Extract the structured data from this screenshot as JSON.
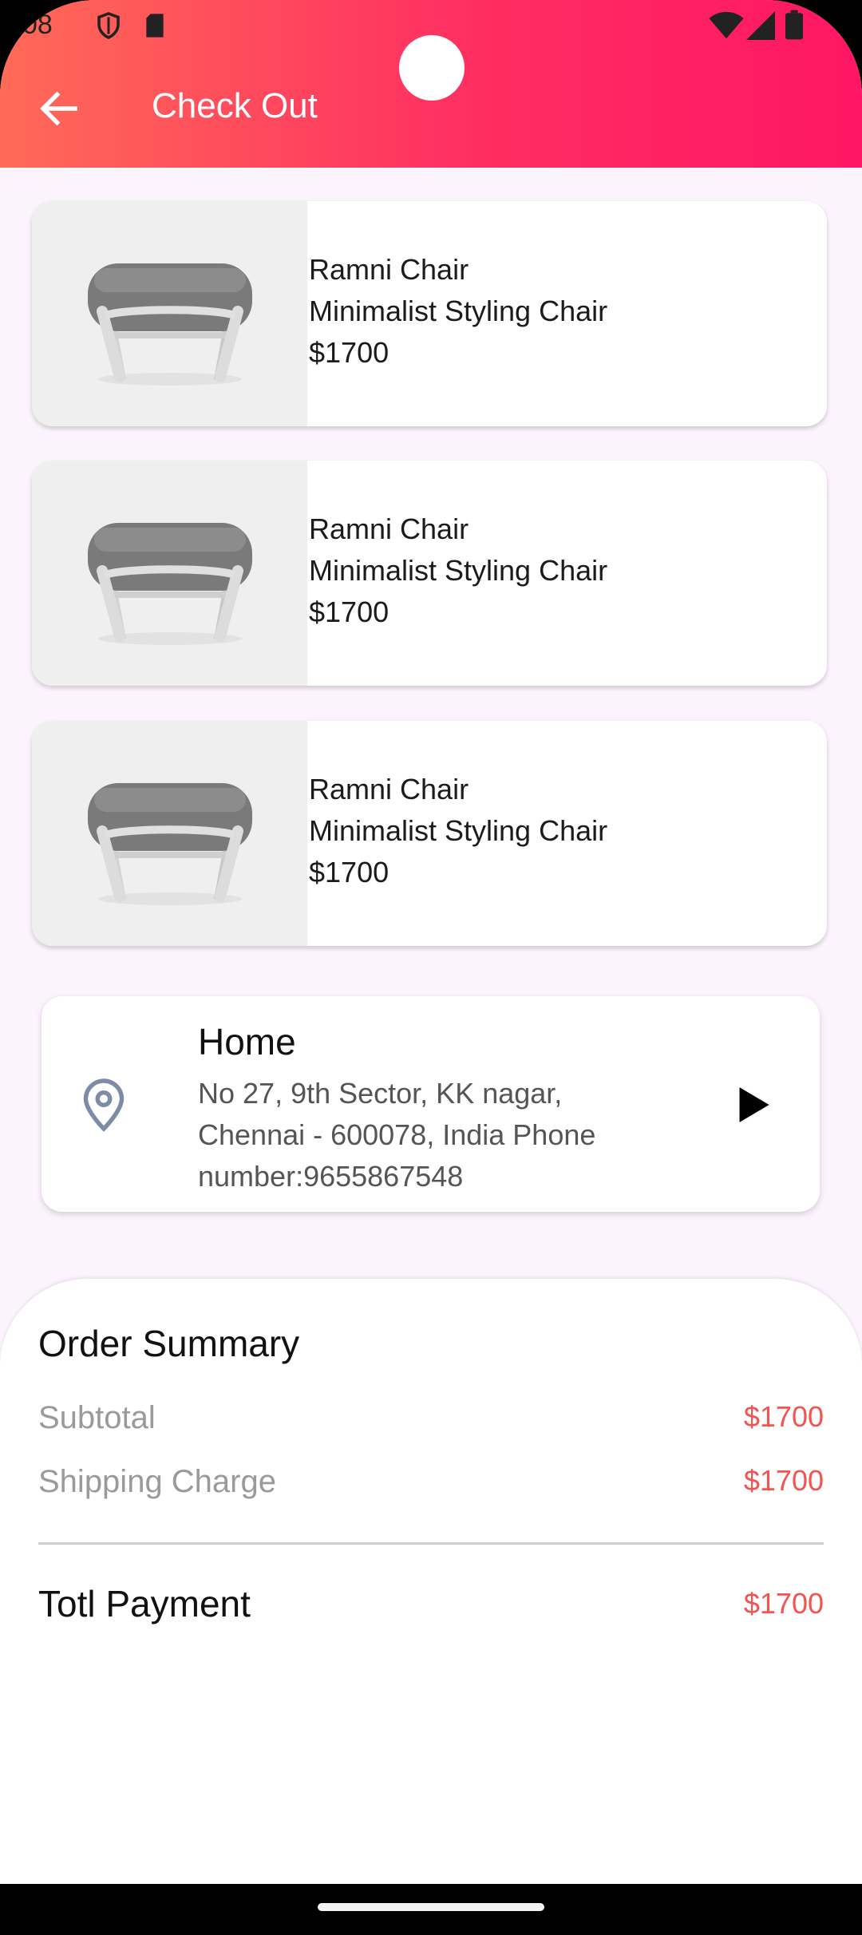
{
  "status_bar": {
    "time": "08",
    "icons": [
      "shield-icon",
      "sd-card-icon",
      "wifi-icon",
      "signal-icon",
      "battery-icon"
    ]
  },
  "header": {
    "title": "Check Out",
    "back_icon": "arrow-left-icon",
    "gradient": [
      "#FF6A57",
      "#FF1664"
    ]
  },
  "products": [
    {
      "name": "Ramni Chair",
      "description": "Minimalist Styling Chair",
      "price": "$1700"
    },
    {
      "name": "Ramni Chair",
      "description": "Minimalist Styling Chair",
      "price": "$1700"
    },
    {
      "name": "Ramni Chair",
      "description": "Minimalist Styling Chair",
      "price": "$1700"
    }
  ],
  "address": {
    "title": "Home",
    "details": "No 27, 9th Sector, KK nagar, Chennai - 600078, India Phone number:9655867548",
    "icon": "location-pin-icon",
    "action_icon": "play-arrow-icon"
  },
  "summary": {
    "title": "Order Summary",
    "rows": [
      {
        "label": "Subtotal",
        "value": "$1700"
      },
      {
        "label": "Shipping Charge",
        "value": "$1700"
      }
    ],
    "total_label": "Totl Payment",
    "total_value": "$1700",
    "accent_color": "#F4534F"
  }
}
